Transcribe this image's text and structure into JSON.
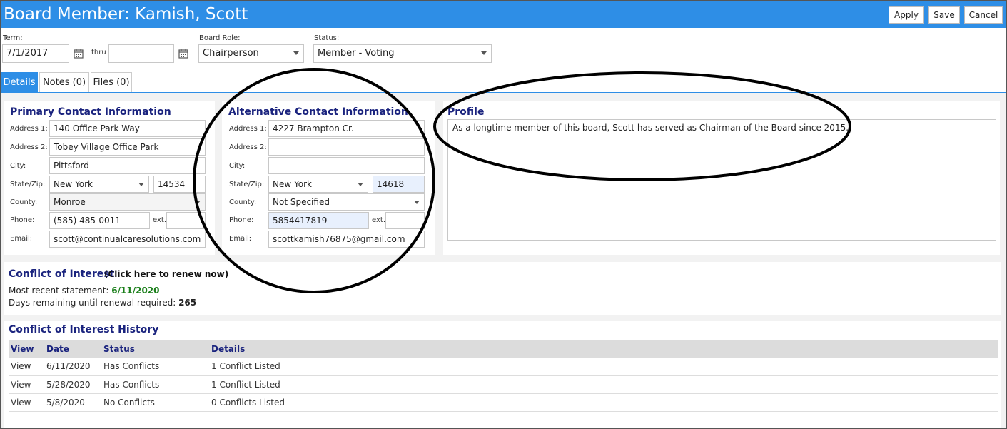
{
  "header": {
    "title": "Board Member: Kamish, Scott",
    "apply_label": "Apply",
    "save_label": "Save",
    "cancel_label": "Cancel"
  },
  "term": {
    "label": "Term:",
    "start_value": "7/1/2017",
    "thru_label": "thru",
    "end_value": ""
  },
  "board_role": {
    "label": "Board Role:",
    "value": "Chairperson"
  },
  "status": {
    "label": "Status:",
    "value": "Member - Voting"
  },
  "tabs": [
    {
      "label": "Details"
    },
    {
      "label": "Notes (0)"
    },
    {
      "label": "Files (0)"
    }
  ],
  "primary": {
    "title": "Primary Contact Information",
    "address1_label": "Address 1:",
    "address1": "140 Office Park Way",
    "address2_label": "Address 2:",
    "address2": "Tobey Village Office Park",
    "city_label": "City:",
    "city": "Pittsford",
    "statezip_label": "State/Zip:",
    "state": "New York",
    "zip": "14534",
    "county_label": "County:",
    "county": "Monroe",
    "phone_label": "Phone:",
    "phone": "(585) 485-0011",
    "ext_label": "ext.",
    "ext": "",
    "email_label": "Email:",
    "email": "scott@continualcaresolutions.com"
  },
  "alternative": {
    "title": "Alternative Contact Information",
    "address1_label": "Address 1:",
    "address1": "4227 Brampton Cr.",
    "address2_label": "Address 2:",
    "address2": "",
    "city_label": "City:",
    "city": "",
    "statezip_label": "State/Zip:",
    "state": "New York",
    "zip": "14618",
    "county_label": "County:",
    "county": "Not Specified",
    "phone_label": "Phone:",
    "phone": "5854417819",
    "ext_label": "ext.",
    "ext": "",
    "email_label": "Email:",
    "email": "scottkamish76875@gmail.com"
  },
  "profile": {
    "title": "Profile",
    "text": "As a longtime member of this board, Scott has served as Chairman of the Board since 2015."
  },
  "coi": {
    "title": "Conflict of Interest",
    "renew_link": "(Click here to renew now)",
    "recent_label": "Most recent statement:",
    "recent_value": "6/11/2020",
    "days_label": "Days remaining until renewal required:",
    "days_value": "265"
  },
  "history": {
    "title": "Conflict of Interest History",
    "columns": [
      "View",
      "Date",
      "Status",
      "Details"
    ],
    "rows": [
      {
        "view": "View",
        "date": "6/11/2020",
        "status": "Has Conflicts",
        "details": "1 Conflict Listed"
      },
      {
        "view": "View",
        "date": "5/28/2020",
        "status": "Has Conflicts",
        "details": "1 Conflict Listed"
      },
      {
        "view": "View",
        "date": "5/8/2020",
        "status": "No Conflicts",
        "details": "0 Conflicts Listed"
      }
    ]
  },
  "colors": {
    "header_blue": "#2e8ee6",
    "section_title": "#1a237e",
    "date_green": "#1b7f1b",
    "annotation_ink": "#000000"
  }
}
